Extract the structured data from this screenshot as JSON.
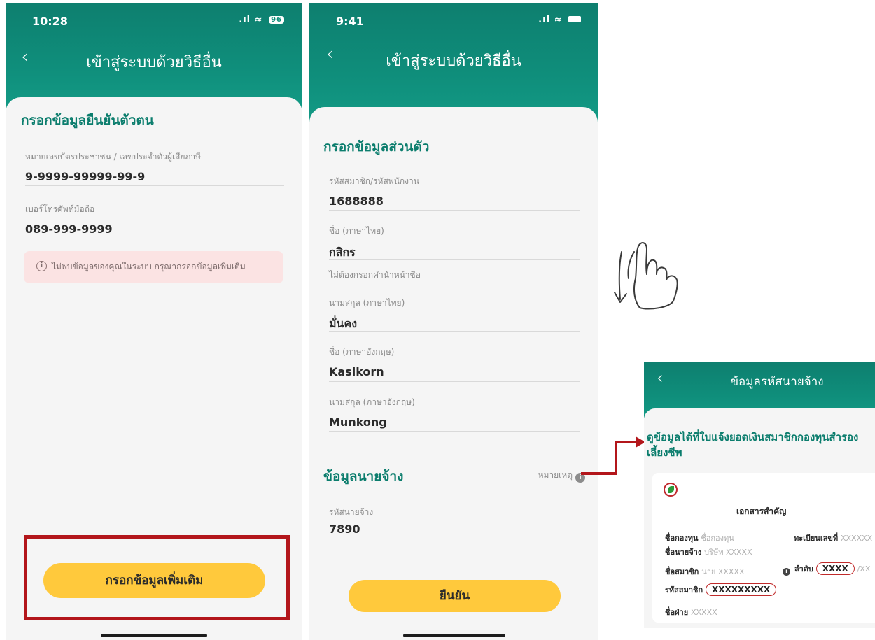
{
  "screen1": {
    "status_time": "10:28",
    "battery": "96",
    "title": "เข้าสู่ระบบด้วยวิธีอื่น",
    "section_title": "กรอกข้อมูลยืนยันตัวตน",
    "fields": [
      {
        "label": "หมายเลขบัตรประชาชน / เลขประจำตัวผู้เสียภาษี",
        "value": "9-9999-99999-99-9"
      },
      {
        "label": "เบอร์โทรศัพท์มือถือ",
        "value": "089-999-9999"
      }
    ],
    "alert_icon": "info-icon",
    "alert_text": "ไม่พบข้อมูลของคุณในระบบ กรุณากรอกข้อมูลเพิ่มเติม",
    "button_label": "กรอกข้อมูลเพิ่มเติม"
  },
  "screen2": {
    "status_time": "9:41",
    "title": "เข้าสู่ระบบด้วยวิธีอื่น",
    "section_title": "กรอกข้อมูลส่วนตัว",
    "fields": [
      {
        "label": "รหัสสมาชิก/รหัสพนักงาน",
        "value": "1688888"
      },
      {
        "label": "ชื่อ (ภาษาไทย)",
        "value": "กสิกร"
      },
      {
        "label": "ไม่ต้องกรอกคำนำหน้าชื่อ",
        "value": ""
      },
      {
        "label": "นามสกุล (ภาษาไทย)",
        "value": "มั่นคง"
      },
      {
        "label": "ชื่อ (ภาษาอังกฤษ)",
        "value": "Kasikorn"
      },
      {
        "label": "นามสกุล (ภาษาอังกฤษ)",
        "value": "Munkong"
      }
    ],
    "employer_title": "ข้อมูลนายจ้าง",
    "note_label": "หมายเหตุ",
    "employer_code_label": "รหัสนายจ้าง",
    "employer_code_value": "7890",
    "button_label": "ยืนยัน"
  },
  "gesture": {
    "icon": "swipe-down-hand-icon"
  },
  "screen3": {
    "title": "ข้อมูลรหัสนายจ้าง",
    "heading": "ดูข้อมูลได้ที่ใบแจ้งยอดเงินสมาชิกกองทุนสำรองเลี้ยงชีพ",
    "heading_line1": "ดูข้อมูลได้ที่ใบแจ้งยอดเงินสมาชิกกองทุนสำรอง",
    "heading_line2": "เลี้ยงชีพ",
    "doc_title": "เอกสารสำคัญ",
    "fund_name_label": "ชื่อกองทุน",
    "fund_name_value": "ชื่อกองทุน",
    "reg_no_label": "ทะเบียนเลขที่",
    "reg_no_value": "XXXXXX",
    "employer_label": "ชื่อนายจ้าง",
    "employer_value": "บริษัท XXXXX",
    "member_label": "ชื่อสมาชิก",
    "member_value": "นาย XXXXX",
    "order_label": "ลำดับ",
    "order_value": "XXXX",
    "order_suffix": "/XX",
    "member_code_label": "รหัสสมาชิก",
    "member_code_value": "XXXXXXXXX",
    "dept_label": "ชื่อฝ่าย",
    "dept_value": "XXXXX"
  },
  "colors": {
    "brand_green": "#0f8e7b",
    "button_yellow": "#ffc93c",
    "highlight_red": "#b3161b"
  }
}
